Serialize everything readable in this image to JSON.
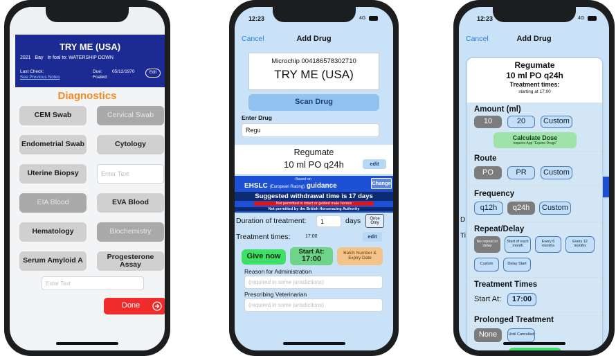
{
  "p1": {
    "horse_name": "TRY ME (USA)",
    "year": "2021",
    "color": "Bay",
    "foal_info": "In foal to: WATERSHIP DOWN",
    "last_check": "Last Check:",
    "see_notes": "See Previous Notes",
    "due_label": "Due:",
    "due_date": "05/12/1970",
    "foaled_label": "Foaled:",
    "edit": "Edit",
    "section_title": "Diagnostics",
    "buttons": [
      "CEM Swab",
      "Cervical Swab",
      "Endometrial Swab",
      "Cytology",
      "Uterine Biopsy",
      "EIA Blood",
      "EVA Blood",
      "Hematology",
      "Biochemistry",
      "Serum Amyloid A",
      "Progesterone Assay"
    ],
    "text_placeholder": "Enter Text",
    "text_placeholder2": "Enter Text",
    "done": "Done",
    "done_icon": "arrow-right-circle-icon"
  },
  "p2": {
    "time": "12:23",
    "network": "4G",
    "cancel": "Cancel",
    "title": "Add Drug",
    "microchip": "Microchip 004186578302710",
    "horse_name": "TRY ME (USA)",
    "scan": "Scan Drug",
    "enter_drug_label": "Enter Drug",
    "drug_value": "Regu",
    "drug_name": "Regumate",
    "dose": "10 ml PO q24h",
    "edit": "edit",
    "based_on": "Based on",
    "ehslc": "EHSLC",
    "european": "(European Racing)",
    "guidance": "guidance",
    "change": "Change",
    "withdrawal": "Suggested withdrawal time is 17 days",
    "not_permitted1": "Not permitted in intact or gelded male horses",
    "not_permitted2": "Not permitted by the British Horseracing Authority",
    "duration_label": "Duration of treatment:",
    "duration_value": "1",
    "days": "days",
    "once_only": "Once Only",
    "treatment_times_label": "Treatment times:",
    "treatment_times_value": "17:00",
    "edit2": "edit",
    "give_now": "Give now",
    "start_at": "Start At:",
    "start_time": "17:00",
    "batch": "Batch Number & Expiry Date",
    "reason_label": "Reason for Administration",
    "reason_placeholder": "(required in some jurisdictions)",
    "vet_label": "Prescribing Veterinarian",
    "vet_placeholder": "(required in some jurisdictions)"
  },
  "p3": {
    "time": "12:23",
    "network": "4G",
    "cancel": "Cancel",
    "title": "Add Drug",
    "drug_name": "Regumate",
    "dose": "10 ml PO q24h",
    "treatment_times": "Treatment times:",
    "starting": "starting at 17:00",
    "amount_label": "Amount (ml)",
    "amounts": [
      "10",
      "20",
      "Custom"
    ],
    "calc": "Calculate Dose",
    "calc_sub": "requires App \"Equine Drugs\"",
    "route_label": "Route",
    "routes": [
      "PO",
      "PR",
      "Custom"
    ],
    "freq_label": "Frequency",
    "freqs": [
      "q12h",
      "q24h",
      "Custom"
    ],
    "repeat_label": "Repeat/Delay",
    "repeats": [
      "No repeat or delay",
      "Start of each month",
      "Every 6 months",
      "Every 12 months",
      "Custom",
      "Delay Start"
    ],
    "tt_label": "Treatment Times",
    "start_at": "Start At:",
    "start_time": "17:00",
    "prolonged_label": "Prolonged Treatment",
    "prolonged": [
      "None",
      "Until Cancelled"
    ],
    "bg_d": "D",
    "bg_t": "Ti"
  }
}
